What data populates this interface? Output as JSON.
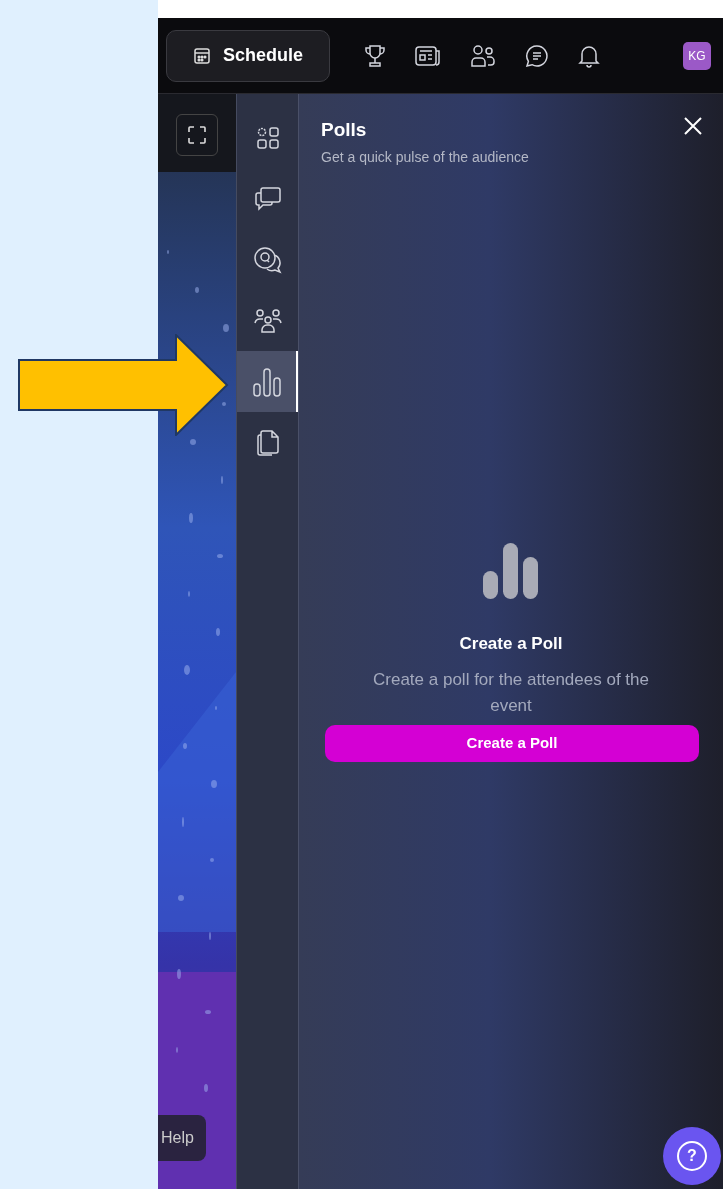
{
  "header": {
    "schedule_button": "Schedule",
    "nav_icons": [
      {
        "kind": "trophy"
      },
      {
        "kind": "news"
      },
      {
        "kind": "people"
      },
      {
        "kind": "chat"
      },
      {
        "kind": "bell"
      }
    ],
    "avatar": "KG"
  },
  "stage": {
    "kind": "picture",
    "help_tab": "Help"
  },
  "rail": {
    "items": [
      {
        "kind": "apps",
        "selected": false
      },
      {
        "kind": "chat",
        "selected": false
      },
      {
        "kind": "qa",
        "selected": false
      },
      {
        "kind": "people",
        "selected": false
      },
      {
        "kind": "polls",
        "selected": true
      },
      {
        "kind": "files",
        "selected": false
      }
    ]
  },
  "panel": {
    "title": "Polls",
    "subtitle": "Get a quick pulse of the audience",
    "empty_title": "Create a Poll",
    "empty_text": "Create a poll for the attendees of the event",
    "button": "Create a Poll"
  },
  "help_button": "?"
}
